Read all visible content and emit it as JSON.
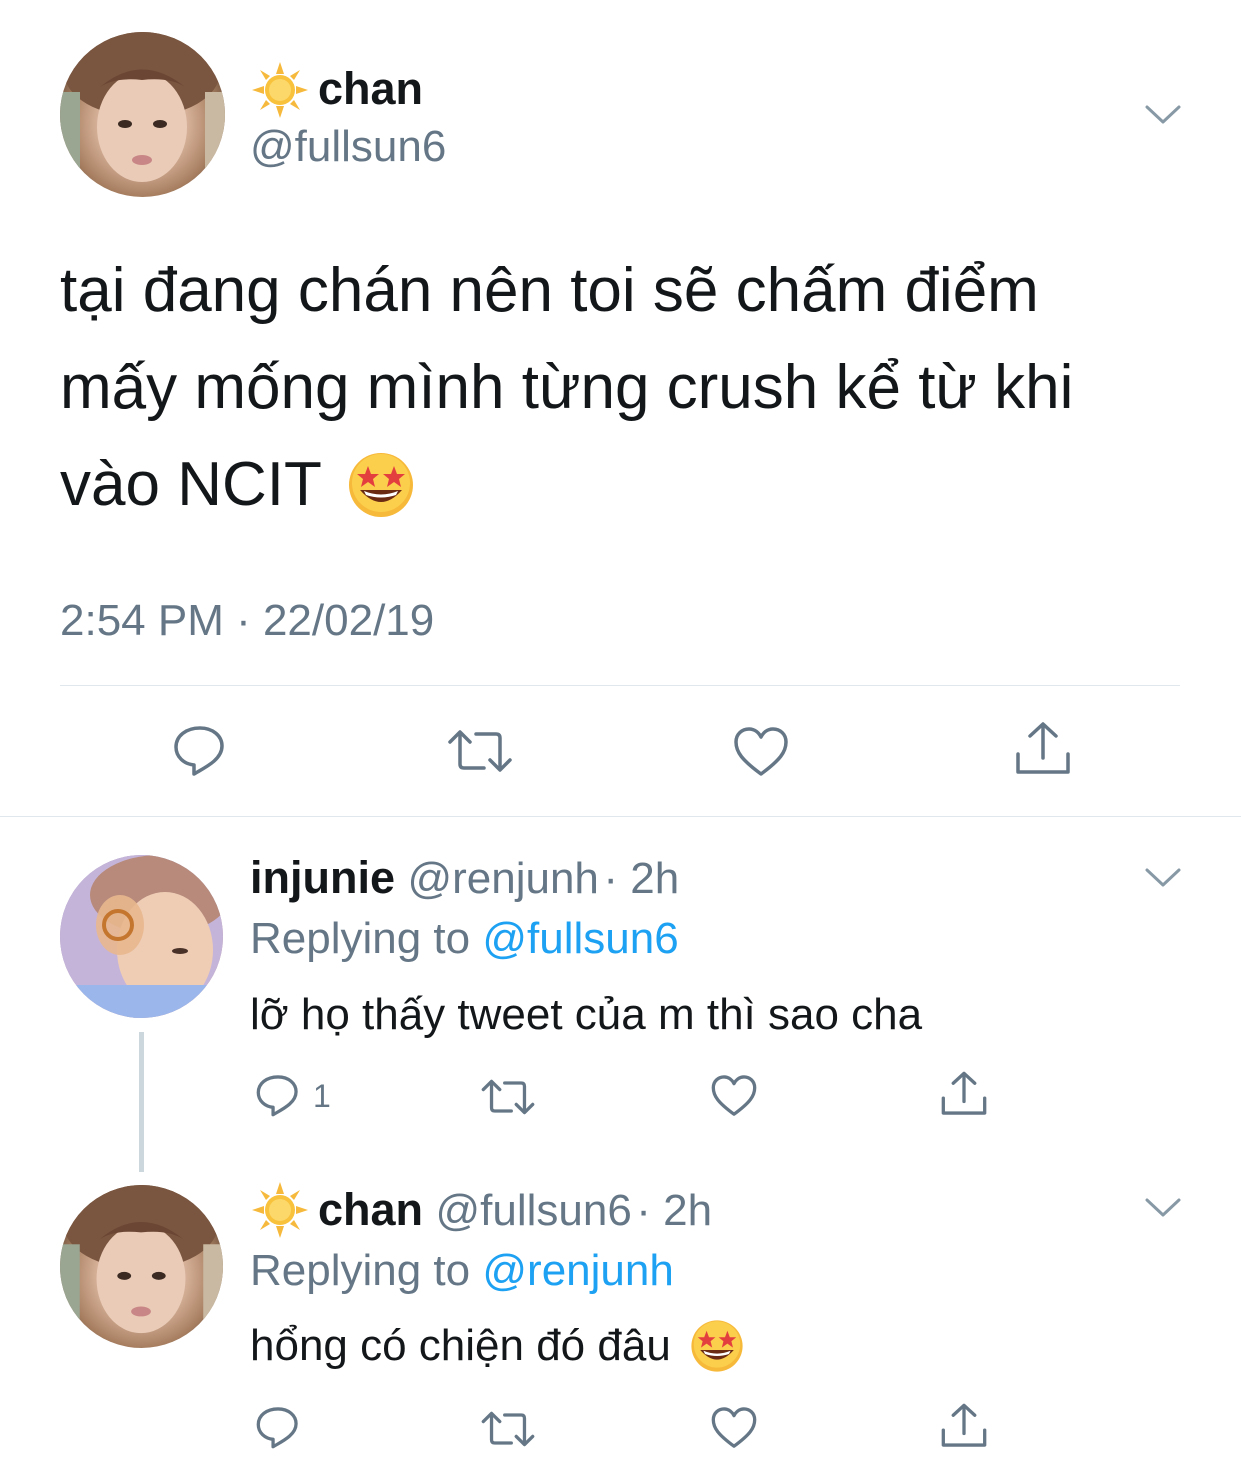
{
  "main_tweet": {
    "display_name": "chan",
    "handle": "@fullsun6",
    "text_lines": [
      "tại đang chán nên toi sẽ chấm điểm",
      "mấy mống mình từng crush kể từ khi",
      "vào NCIT"
    ],
    "timestamp": "2:54 PM · 22/02/19",
    "emoji": "star-struck-emoji"
  },
  "replies": [
    {
      "display_name": "injunie",
      "handle": "@renjunh",
      "time": "· 2h",
      "replying_label": "Replying to",
      "replying_to": "@fullsun6",
      "text": "lỡ họ thấy tweet của m thì sao cha",
      "reply_count": "1"
    },
    {
      "display_name": "chan",
      "handle": "@fullsun6",
      "time": "· 2h",
      "replying_label": "Replying to",
      "replying_to": "@renjunh",
      "text": "hổng có chiện đó đâu"
    }
  ],
  "colors": {
    "text": "#14171a",
    "secondary": "#657786",
    "link": "#1da1f2",
    "divider": "#e1e8ed",
    "thread_line": "#ccd6dd"
  }
}
